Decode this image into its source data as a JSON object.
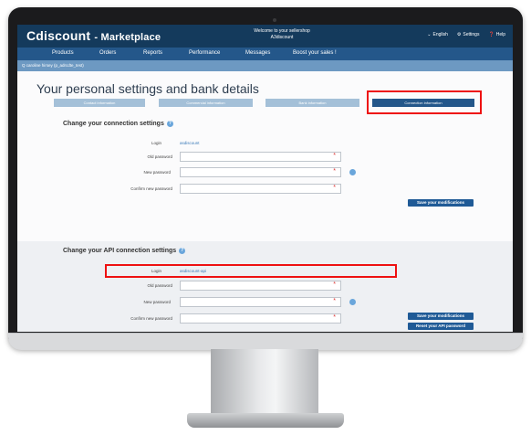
{
  "header": {
    "brand": "Cdiscount",
    "brand_sub": "- Marketplace",
    "welcome_line1": "Welcome to your sellershop",
    "welcome_line2": "A3discount",
    "links": [
      {
        "label": "English",
        "icon": "chevron-down-icon"
      },
      {
        "label": "Settings",
        "icon": "gear-icon"
      },
      {
        "label": "Help",
        "icon": "help-icon"
      }
    ]
  },
  "nav": {
    "items": [
      "Products",
      "Orders",
      "Reports",
      "Performance",
      "Messages",
      "Boost your sales !"
    ]
  },
  "breadcrumb": "Q caroline hirsey (p_adrcdte_test)",
  "page": {
    "title": "Your personal settings and bank details",
    "tabs": [
      "Contact information",
      "Commercial information",
      "Bank information",
      "Connection information"
    ]
  },
  "connection": {
    "title": "Change your connection settings",
    "login_label": "Login",
    "login_value": "asdiscount",
    "old_password_label": "Old password",
    "new_password_label": "New password",
    "confirm_label": "Confirm new password",
    "required_mark": "*",
    "save_label": "Save your modifications"
  },
  "api": {
    "title": "Change your API connection settings",
    "login_label": "Login",
    "login_value": "asdiscount-api",
    "old_password_label": "Old password",
    "new_password_label": "New password",
    "confirm_label": "Confirm new password",
    "required_mark": "*",
    "save_label": "Save your modifications",
    "reset_label": "Reset your API password"
  },
  "colors": {
    "topbar": "#143a5c",
    "navbar": "#24578a",
    "breadcrumb_bar": "#6d99c2",
    "tab_active": "#24578a",
    "tab_inactive": "#a4c0d8",
    "highlight": "#e11111"
  }
}
